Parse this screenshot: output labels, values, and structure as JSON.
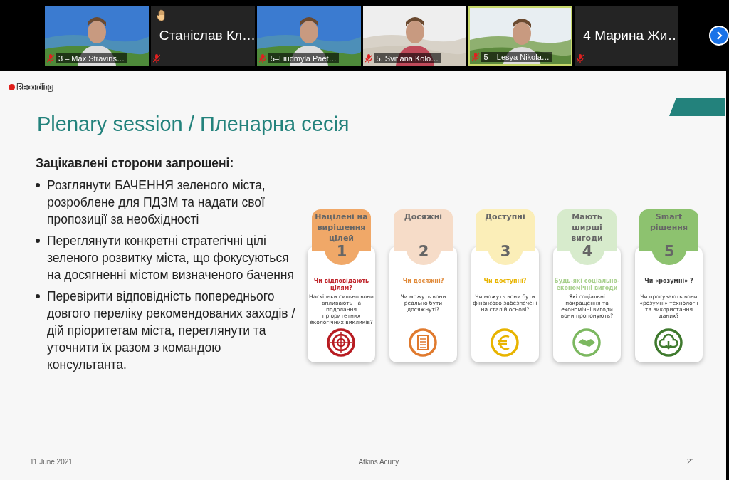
{
  "participants": [
    {
      "kind": "video",
      "name": "3 – Max Stravins…",
      "muted": true,
      "active": false
    },
    {
      "kind": "name",
      "name": "Станіслав Кл…",
      "muted": true,
      "active": false,
      "raised_hand": true
    },
    {
      "kind": "video",
      "name": "5–Liudmyla Paet…",
      "muted": true,
      "active": false
    },
    {
      "kind": "video",
      "name": "5. Svitlana Kolo…",
      "muted": true,
      "active": false
    },
    {
      "kind": "video",
      "name": "5 – Lesya Nikola…",
      "muted": true,
      "active": true
    },
    {
      "kind": "name",
      "name": "4 Марина Жи…",
      "muted": true,
      "active": false,
      "raised_hand": false
    }
  ],
  "recording": "Recording",
  "slide": {
    "title": "Plenary session / Пленарна сесія",
    "heading": "Зацікавлені сторони запрошені:",
    "bullets": [
      "Розглянути БАЧЕННЯ зеленого міста, розроблене для ПДЗМ та надати свої пропозиції за необхідності",
      "Переглянути конкретні стратегічні цілі зеленого розвитку міста, що фокусуються на досягненні містом визначеного бачення",
      "Перевірити відповідність попереднього довгого переліку рекомендованих заходів / дій пріоритетам міста, переглянути та уточнити їх разом з командою консультанта."
    ],
    "cards": [
      {
        "kind": "target",
        "title": "Націлені на вирішення цілей",
        "number": "1",
        "question": "Чи відповідають цілям?",
        "description": "Наскільки сильно вони впливають на подолання пріоритетних екологічних викликів?",
        "color": "#f0a868"
      },
      {
        "kind": "checklist",
        "title": "Досяжні",
        "number": "2",
        "question": "Чи досяжні?",
        "description": "Чи можуть вони реально бути досяжнуті?",
        "color": "#f6dcc8"
      },
      {
        "kind": "euro",
        "title": "Доступні",
        "number": "3",
        "question": "Чи доступні?",
        "description": "Чи можуть вони бути фінансово забезпечені на сталій основі?",
        "color": "#fbeeb8"
      },
      {
        "kind": "handshake",
        "title": "Мають ширші вигоди",
        "number": "4",
        "question": "Будь-які соціально-економічні вигоди",
        "description": "Які соціальні покращення та економічні вигоди вони пропонують?",
        "color": "#d7ebcc"
      },
      {
        "kind": "cloud",
        "title": "Smart рішення",
        "number": "5",
        "question": "Чи «розумні» ?",
        "description": "Чи просувають вони «розумні» технології та використання даних?",
        "color": "#8dc26f"
      }
    ],
    "date": "11 June 2021",
    "company": "Atkins Acuity",
    "page": "21"
  }
}
